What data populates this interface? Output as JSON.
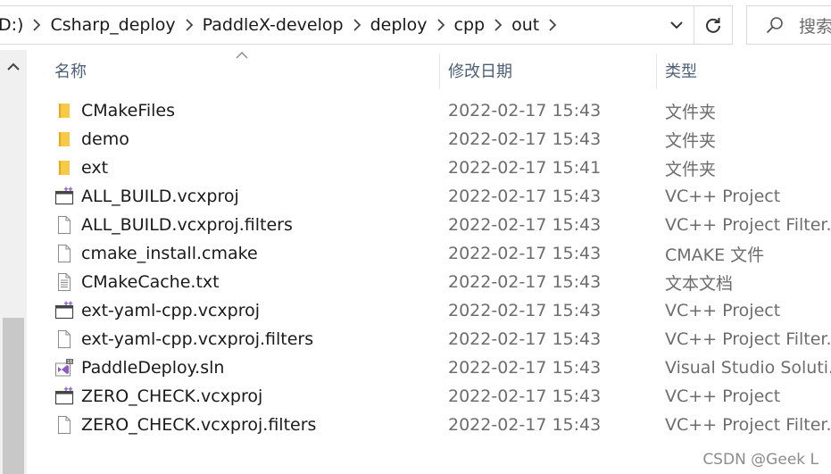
{
  "address_bar": {
    "root": "D:)",
    "crumbs": [
      "Csharp_deploy",
      "PaddleX-develop",
      "deploy",
      "cpp",
      "out"
    ]
  },
  "search": {
    "placeholder": "搜索"
  },
  "columns": {
    "name": "名称",
    "date": "修改日期",
    "type": "类型"
  },
  "files": [
    {
      "name": "CMakeFiles",
      "date": "2022-02-17 15:43",
      "type": "文件夹",
      "icon": "folder-icon"
    },
    {
      "name": "demo",
      "date": "2022-02-17 15:43",
      "type": "文件夹",
      "icon": "folder-icon"
    },
    {
      "name": "ext",
      "date": "2022-02-17 15:41",
      "type": "文件夹",
      "icon": "folder-icon"
    },
    {
      "name": "ALL_BUILD.vcxproj",
      "date": "2022-02-17 15:43",
      "type": "VC++ Project",
      "icon": "vcxproj-icon"
    },
    {
      "name": "ALL_BUILD.vcxproj.filters",
      "date": "2022-02-17 15:43",
      "type": "VC++ Project Filter...",
      "icon": "file-icon"
    },
    {
      "name": "cmake_install.cmake",
      "date": "2022-02-17 15:43",
      "type": "CMAKE 文件",
      "icon": "file-icon"
    },
    {
      "name": "CMakeCache.txt",
      "date": "2022-02-17 15:43",
      "type": "文本文档",
      "icon": "text-file-icon"
    },
    {
      "name": "ext-yaml-cpp.vcxproj",
      "date": "2022-02-17 15:43",
      "type": "VC++ Project",
      "icon": "vcxproj-icon"
    },
    {
      "name": "ext-yaml-cpp.vcxproj.filters",
      "date": "2022-02-17 15:43",
      "type": "VC++ Project Filter...",
      "icon": "file-icon"
    },
    {
      "name": "PaddleDeploy.sln",
      "date": "2022-02-17 15:43",
      "type": "Visual Studio Soluti...",
      "icon": "sln-icon"
    },
    {
      "name": "ZERO_CHECK.vcxproj",
      "date": "2022-02-17 15:43",
      "type": "VC++ Project",
      "icon": "vcxproj-icon"
    },
    {
      "name": "ZERO_CHECK.vcxproj.filters",
      "date": "2022-02-17 15:43",
      "type": "VC++ Project Filter...",
      "icon": "file-icon"
    }
  ],
  "watermark": "CSDN @Geek L",
  "colors": {
    "folder": "#f8c946",
    "header_text": "#4c607a",
    "vs_purple": "#8a5cc9"
  }
}
